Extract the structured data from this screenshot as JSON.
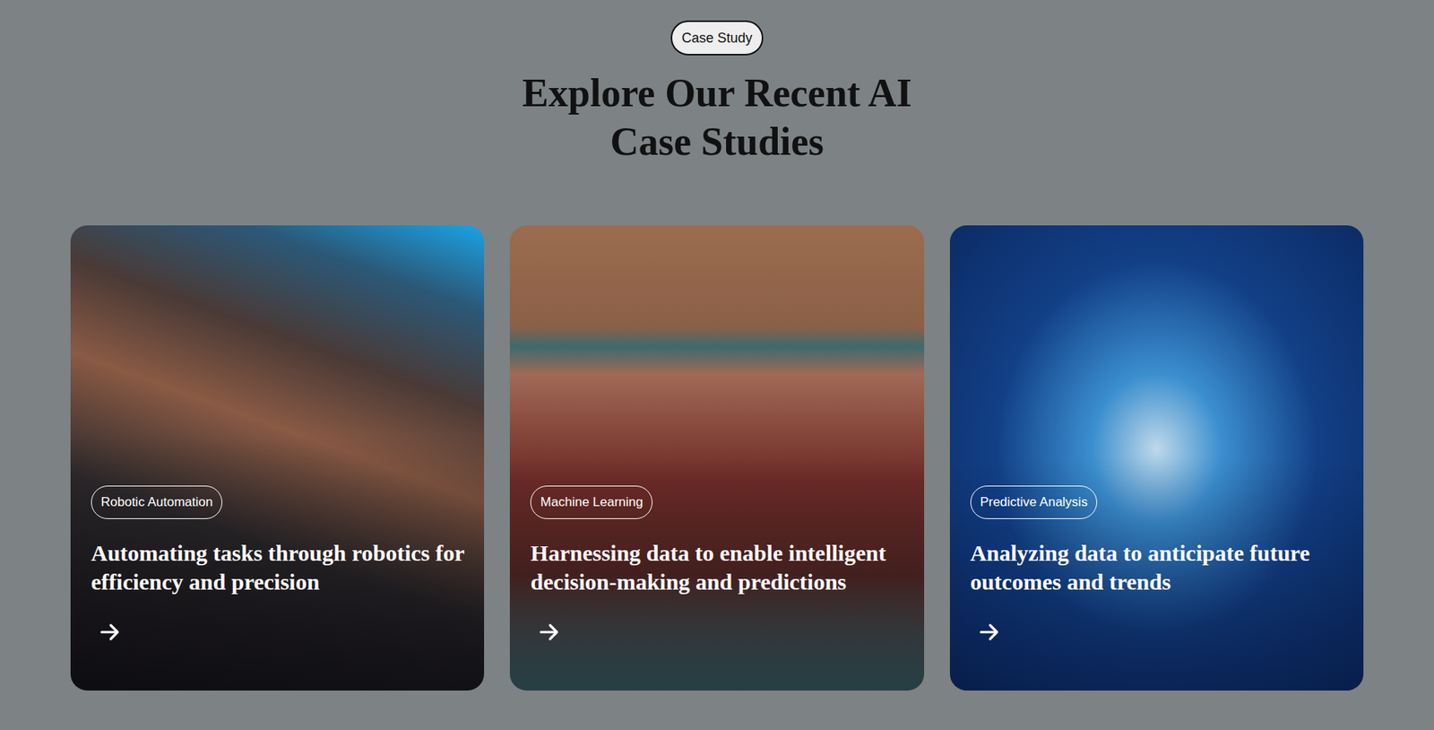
{
  "badge": "Case Study",
  "heading": "Explore Our Recent AI Case Studies",
  "cards": [
    {
      "tag": "Robotic Automation",
      "title": "Automating tasks through robotics for efficiency and precision"
    },
    {
      "tag": "Machine Learning",
      "title": "Harnessing data to enable intelligent decision-making and predictions"
    },
    {
      "tag": "Predictive Analysis",
      "title": "Analyzing data to anticipate future outcomes and trends"
    }
  ]
}
